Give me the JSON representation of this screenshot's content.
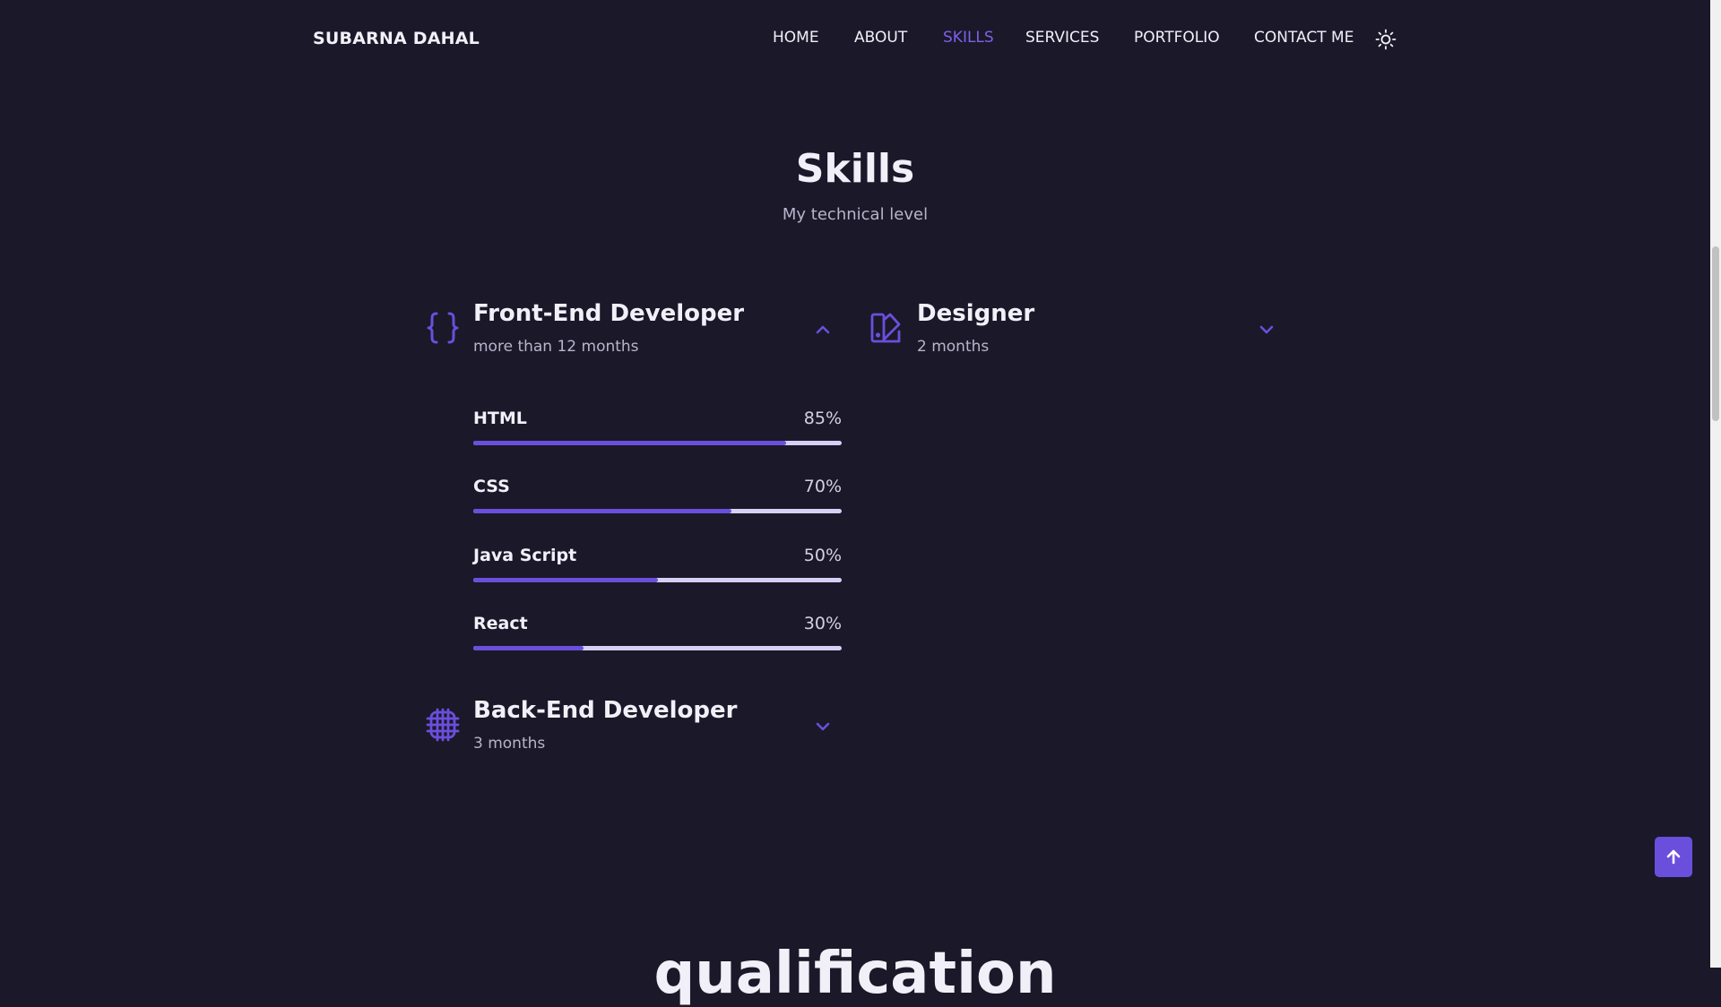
{
  "header": {
    "logo": "SUBARNA DAHAL",
    "nav": [
      {
        "label": "HOME",
        "active": false
      },
      {
        "label": "ABOUT",
        "active": false
      },
      {
        "label": "SKILLS",
        "active": true
      },
      {
        "label": "SERVICES",
        "active": false
      },
      {
        "label": "PORTFOLIO",
        "active": false
      },
      {
        "label": "CONTACT ME",
        "active": false
      }
    ],
    "theme_icon": "sun-icon"
  },
  "skills": {
    "title": "Skills",
    "subtitle": "My technical level",
    "groups": [
      {
        "title": "Front-End Developer",
        "subtitle": "more than 12 months",
        "icon": "braces-icon",
        "expanded": true,
        "items": [
          {
            "name": "HTML",
            "percent_label": "85%",
            "percent": 85
          },
          {
            "name": "CSS",
            "percent_label": "70%",
            "percent": 70
          },
          {
            "name": "Java Script",
            "percent_label": "50%",
            "percent": 50
          },
          {
            "name": "React",
            "percent_label": "30%",
            "percent": 30
          }
        ]
      },
      {
        "title": "Designer",
        "subtitle": "2 months",
        "icon": "swatchbook-icon",
        "expanded": false
      },
      {
        "title": "Back-End Developer",
        "subtitle": "3 months",
        "icon": "server-icon",
        "expanded": false
      }
    ]
  },
  "next_section": {
    "title": "qualification"
  },
  "scroll_top": {
    "icon": "arrow-up-icon"
  },
  "colors": {
    "background": "#1b1829",
    "accent": "#6a4fdc",
    "accent_text": "#7b61e6",
    "bar_track": "#d6d0f7"
  }
}
